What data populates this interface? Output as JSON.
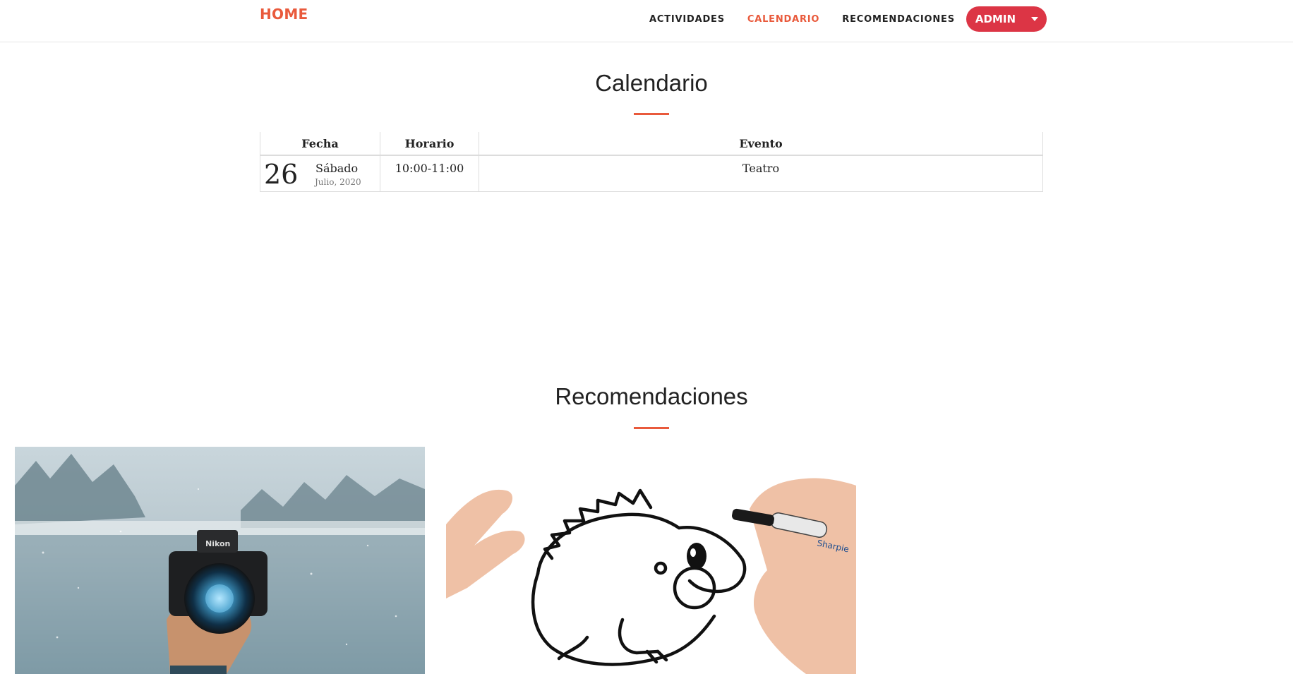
{
  "navbar": {
    "brand": "HOME",
    "links": [
      {
        "label": "ACTIVIDADES"
      },
      {
        "label": "CALENDARIO"
      },
      {
        "label": "RECOMENDACIONES"
      }
    ],
    "admin_label": "ADMIN"
  },
  "calendar": {
    "title": "Calendario",
    "headers": {
      "fecha": "Fecha",
      "horario": "Horario",
      "evento": "Evento"
    },
    "rows": [
      {
        "day": "26",
        "weekday": "Sábado",
        "month_year": "Julio, 2020",
        "time": "10:00-11:00",
        "event": "Teatro"
      }
    ]
  },
  "recommendations": {
    "title": "Recomendaciones"
  },
  "colors": {
    "accent": "#e95a3c",
    "admin_button": "#dc3545"
  }
}
